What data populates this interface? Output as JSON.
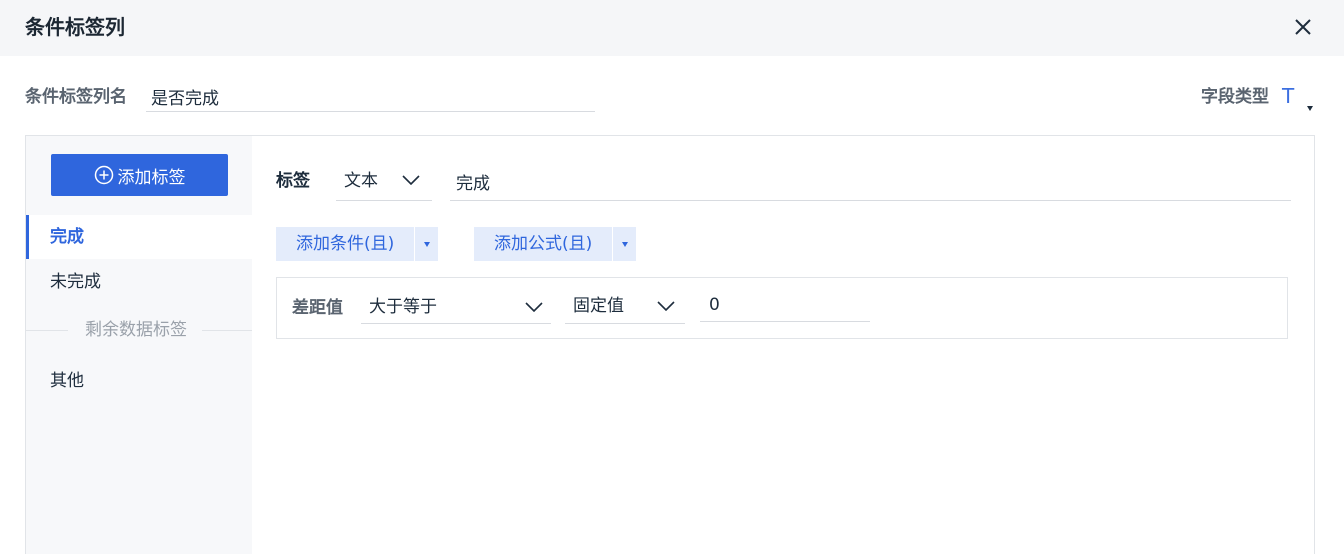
{
  "dialog": {
    "title": "条件标签列",
    "close_icon": "close-icon"
  },
  "name_row": {
    "label": "条件标签列名",
    "value": "是否完成",
    "field_type_label": "字段类型",
    "field_type_icon": "text-type-icon",
    "field_type_glyph": "T"
  },
  "sidebar": {
    "add_tag_label": "添加标签",
    "items": [
      {
        "label": "完成",
        "active": true
      },
      {
        "label": "未完成",
        "active": false
      }
    ],
    "divider_label": "剩余数据标签",
    "rest_item": "其他"
  },
  "tag_editor": {
    "label": "标签",
    "type_value": "文本",
    "tag_value": "完成",
    "add_condition_label": "添加条件(且)",
    "add_formula_label": "添加公式(且)"
  },
  "condition": {
    "field": "差距值",
    "operator": "大于等于",
    "value_type": "固定值",
    "value": "0"
  },
  "colors": {
    "accent": "#2f66dd",
    "header_bg": "#f5f6f8",
    "sidebar_bg": "#f7f8fa",
    "split_btn_bg": "#e4ecfb"
  }
}
